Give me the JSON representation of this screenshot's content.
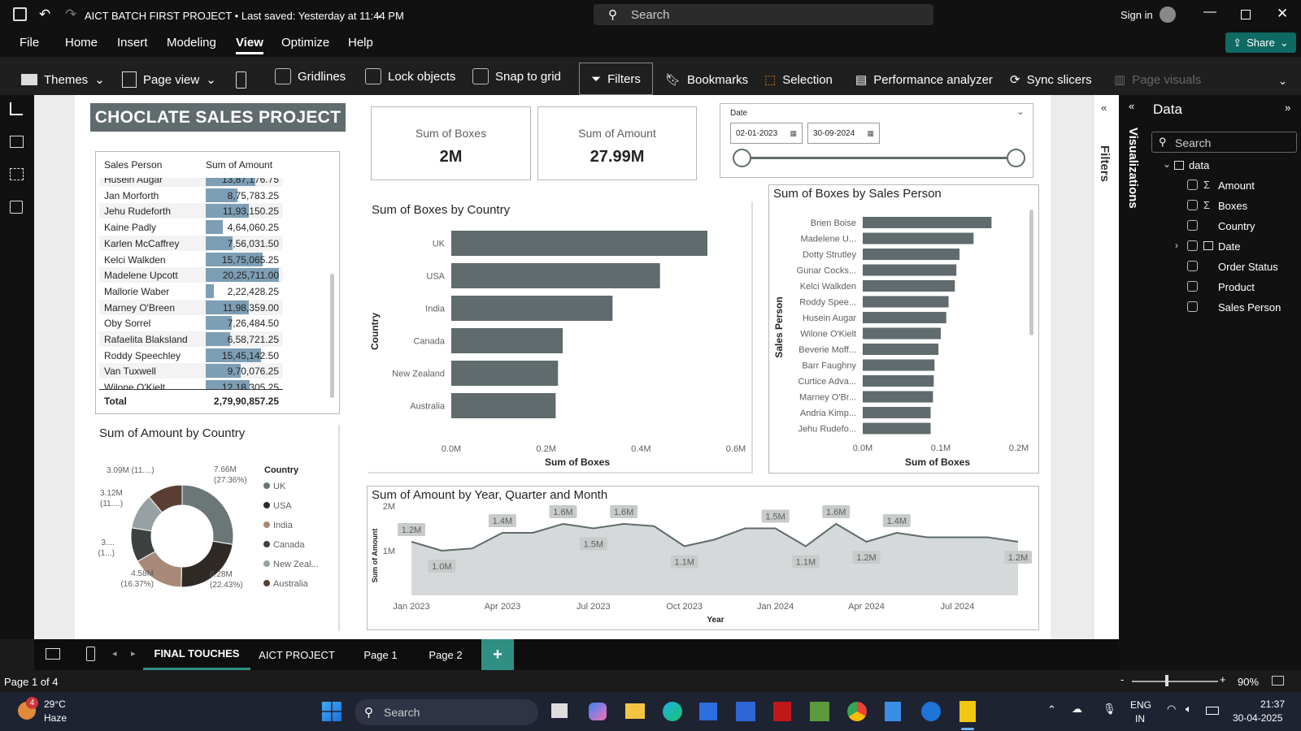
{
  "titlebar": {
    "title": "AICT BATCH FIRST PROJECT • Last saved: Yesterday at 11:44 PM",
    "search": "Search",
    "signin": "Sign in"
  },
  "menu": [
    "File",
    "Home",
    "Insert",
    "Modeling",
    "View",
    "Optimize",
    "Help"
  ],
  "share": "Share",
  "ribbon": {
    "themes": "Themes",
    "page_view": "Page view",
    "gridlines": "Gridlines",
    "lock": "Lock objects",
    "snap": "Snap to grid",
    "filters": "Filters",
    "bookmarks": "Bookmarks",
    "selection": "Selection",
    "perf": "Performance analyzer",
    "sync": "Sync slicers",
    "page_visuals": "Page visuals"
  },
  "report_title": "CHOCLATE SALES PROJECT",
  "cards": [
    {
      "label": "Sum of Boxes",
      "value": "2M"
    },
    {
      "label": "Sum of Amount",
      "value": "27.99M"
    }
  ],
  "slicer": {
    "label": "Date",
    "start": "02-01-2023",
    "end": "30-09-2024"
  },
  "table": {
    "headers": [
      "Sales Person",
      "Sum of Amount"
    ],
    "rows": [
      {
        "name": "Husein Augar",
        "amount": "13,87,176.75",
        "frac": 0.68
      },
      {
        "name": "Jan Morforth",
        "amount": "8,75,783.25",
        "frac": 0.43
      },
      {
        "name": "Jehu Rudeforth",
        "amount": "11,93,150.25",
        "frac": 0.59
      },
      {
        "name": "Kaine Padly",
        "amount": "4,64,060.25",
        "frac": 0.23
      },
      {
        "name": "Karlen McCaffrey",
        "amount": "7,56,031.50",
        "frac": 0.37
      },
      {
        "name": "Kelci Walkden",
        "amount": "15,75,065.25",
        "frac": 0.78
      },
      {
        "name": "Madelene Upcott",
        "amount": "20,25,711.00",
        "frac": 1.0
      },
      {
        "name": "Mallorie Waber",
        "amount": "2,22,428.25",
        "frac": 0.11
      },
      {
        "name": "Marney O'Breen",
        "amount": "11,98,359.00",
        "frac": 0.59
      },
      {
        "name": "Oby Sorrel",
        "amount": "7,26,484.50",
        "frac": 0.36
      },
      {
        "name": "Rafaelita Blaksland",
        "amount": "6,58,721.25",
        "frac": 0.33
      },
      {
        "name": "Roddy Speechley",
        "amount": "15,45,142.50",
        "frac": 0.76
      },
      {
        "name": "Van Tuxwell",
        "amount": "9,70,076.25",
        "frac": 0.48
      },
      {
        "name": "Wilone O'Kielt",
        "amount": "12,18,305.25",
        "frac": 0.6
      }
    ],
    "total_label": "Total",
    "total_value": "2,79,90,857.25"
  },
  "viz_labels": {
    "filters": "Filters",
    "visualizations": "Visualizations",
    "data": "Data",
    "search": "Search"
  },
  "fields": [
    {
      "name": "data"
    },
    {
      "name": "Amount",
      "sigma": true
    },
    {
      "name": "Boxes",
      "sigma": true
    },
    {
      "name": "Country"
    },
    {
      "name": "Date",
      "table_icon": true
    },
    {
      "name": "Order Status"
    },
    {
      "name": "Product"
    },
    {
      "name": "Sales Person"
    }
  ],
  "tabs": [
    "FINAL TOUCHES",
    "AICT PROJECT",
    "Page 1",
    "Page 2"
  ],
  "status": {
    "page": "Page 1 of 4",
    "zoom": "90%"
  },
  "taskbar": {
    "temp": "29°C",
    "weather": "Haze",
    "badge": "4",
    "search": "Search",
    "lang1": "ENG",
    "lang2": "IN",
    "time": "21:37",
    "date": "30-04-2025"
  },
  "colors": {
    "bar": "#5f6b6d",
    "accent": "#2f8f83"
  },
  "chart_data": [
    {
      "type": "bar",
      "title": "Sum of Boxes by Country",
      "xlabel": "Sum of Boxes",
      "ylabel": "Country",
      "categories": [
        "UK",
        "USA",
        "India",
        "Canada",
        "New Zealand",
        "Australia"
      ],
      "values": [
        0.54,
        0.44,
        0.34,
        0.235,
        0.225,
        0.22
      ],
      "xticks": [
        "0.0M",
        "0.2M",
        "0.4M",
        "0.6M"
      ],
      "xlim": [
        0,
        0.6
      ]
    },
    {
      "type": "bar",
      "title": "Sum of Boxes by Sales Person",
      "xlabel": "Sum of Boxes",
      "ylabel": "Sales Person",
      "categories": [
        "Brien Boise",
        "Madelene U...",
        "Dotty Strutley",
        "Gunar Cocks...",
        "Kelci Walkden",
        "Roddy Spee...",
        "Husein Augar",
        "Wilone O'Kielt",
        "Beverie Moff...",
        "Barr Faughny",
        "Curtice Adva...",
        "Marney O'Br...",
        "Andria Kimp...",
        "Jehu Rudefo..."
      ],
      "values": [
        0.165,
        0.142,
        0.124,
        0.12,
        0.118,
        0.11,
        0.107,
        0.1,
        0.097,
        0.092,
        0.091,
        0.09,
        0.087,
        0.087
      ],
      "xticks": [
        "0.0M",
        "0.1M",
        "0.2M"
      ],
      "xlim": [
        0,
        0.2
      ]
    },
    {
      "type": "pie",
      "title": "Sum of Amount by Country",
      "legend_title": "Country",
      "labels": [
        "UK",
        "USA",
        "India",
        "Canada",
        "New Zeal...",
        "Australia"
      ],
      "values": [
        7.66,
        6.28,
        4.58,
        3.0,
        3.12,
        3.09
      ],
      "colors": [
        "#6b7677",
        "#302a27",
        "#a88977",
        "#3d4142",
        "#97a1a3",
        "#5a3d33"
      ],
      "callouts": [
        [
          "7.66M",
          "(27.36%)"
        ],
        [
          "6.28M",
          "(22.43%)"
        ],
        [
          "4.58M",
          "(16.37%)"
        ],
        [
          "3....",
          "(1...)"
        ],
        [
          "3.12M",
          "(11....)"
        ],
        [
          "3.09M (11....)",
          ""
        ]
      ]
    },
    {
      "type": "area",
      "title": "Sum of Amount by Year, Quarter and Month",
      "xlabel": "Year",
      "ylabel": "Sum of Amount",
      "ylim": [
        0,
        2
      ],
      "yticks": [
        "1M",
        "2M"
      ],
      "x": [
        "Jan 2023",
        "Feb 2023",
        "Mar 2023",
        "Apr 2023",
        "May 2023",
        "Jun 2023",
        "Jul 2023",
        "Aug 2023",
        "Sep 2023",
        "Oct 2023",
        "Nov 2023",
        "Dec 2023",
        "Jan 2024",
        "Feb 2024",
        "Mar 2024",
        "Apr 2024",
        "May 2024",
        "Jun 2024",
        "Jul 2024",
        "Aug 2024",
        "Sep 2024"
      ],
      "values": [
        1.2,
        1.0,
        1.05,
        1.4,
        1.4,
        1.6,
        1.5,
        1.6,
        1.55,
        1.1,
        1.25,
        1.5,
        1.5,
        1.1,
        1.6,
        1.2,
        1.4,
        1.3,
        1.3,
        1.3,
        1.2
      ],
      "labels": [
        "1.2M",
        "1.0M",
        "",
        "1.4M",
        "",
        "1.6M",
        "1.5M",
        "1.6M",
        "",
        "1.1M",
        "",
        "",
        "1.5M",
        "1.1M",
        "1.6M",
        "1.2M",
        "1.4M",
        "",
        "",
        "",
        "1.2M"
      ],
      "xticks": [
        "Jan 2023",
        "Apr 2023",
        "Jul 2023",
        "Oct 2023",
        "Jan 2024",
        "Apr 2024",
        "Jul 2024"
      ]
    }
  ]
}
